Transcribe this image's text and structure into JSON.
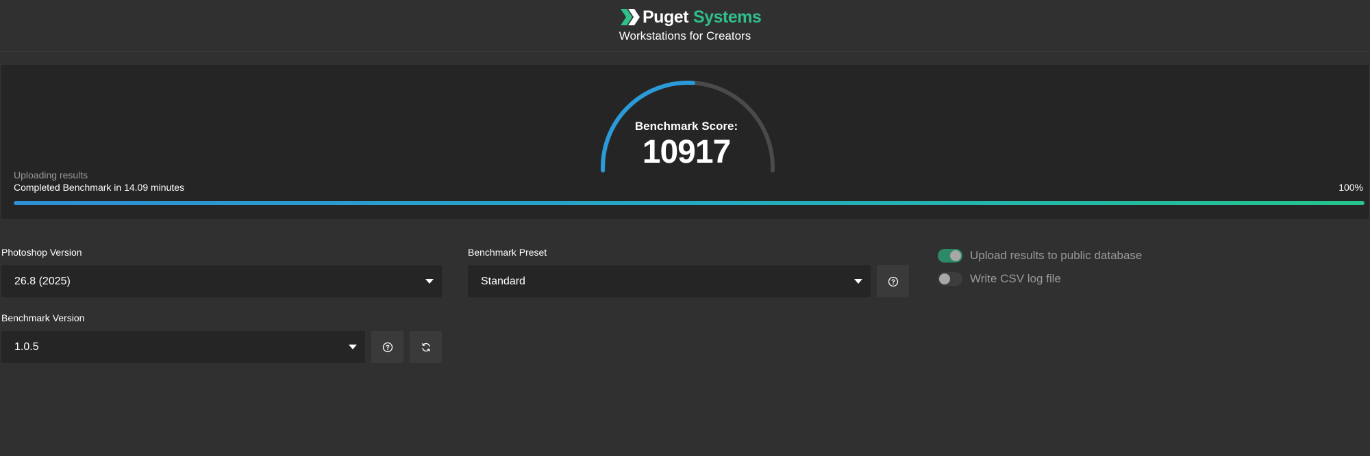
{
  "header": {
    "brand_primary": "Puget",
    "brand_secondary": "Systems",
    "tagline": "Workstations for Creators",
    "logo_icon": "chevron-logo-icon"
  },
  "score": {
    "label": "Benchmark Score:",
    "value": "10917",
    "gauge_fill_fraction": 0.52
  },
  "status": {
    "uploading": "Uploading results",
    "completed": "Completed Benchmark in 14.09 minutes",
    "percent": "100%",
    "progress_fraction": 1.0
  },
  "form": {
    "photoshop_version": {
      "label": "Photoshop Version",
      "value": "26.8 (2025)"
    },
    "benchmark_preset": {
      "label": "Benchmark Preset",
      "value": "Standard"
    },
    "benchmark_version": {
      "label": "Benchmark Version",
      "value": "1.0.5"
    },
    "toggles": [
      {
        "label": "Upload results to public database",
        "on": true
      },
      {
        "label": "Write CSV log file",
        "on": false
      }
    ]
  },
  "colors": {
    "brand_green": "#2ec08a",
    "gauge_blue": "#2b9ad8",
    "gauge_track": "#4a4a4a",
    "toggle_on": "#2e8a66",
    "background": "#303030",
    "panel": "#252525"
  },
  "icons": {
    "help": "question-circle-icon",
    "refresh": "refresh-icon",
    "dropdown": "caret-down-icon"
  }
}
